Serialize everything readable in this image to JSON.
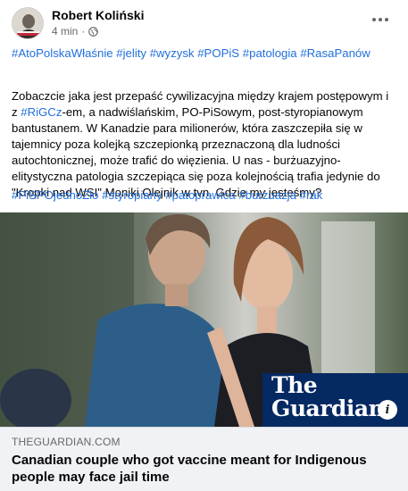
{
  "post": {
    "author": "Robert Koliński",
    "time": "4 min",
    "separator": "·",
    "privacy_icon": "globe-icon",
    "more_icon": "more-horizontal-icon",
    "tags_top": [
      "#AtoPolskaWłaśnie",
      "#jelity",
      "#wyzysk",
      "#POPiS",
      "#patologia",
      "#RasaPanów"
    ],
    "body_part1": "Zobaczcie jaka jest przepaść cywilizacyjna między krajem postępowym i z ",
    "body_tag": "#RiGCz",
    "body_part2": "-em, a nadwiślańskim, PO-PiSowym, post-styropianowym bantustanem. W Kanadzie para milionerów, która zaszczepiła się w tajemnicy poza kolejką szczepionką przeznaczoną dla ludności autochtonicznej, może trafić do więzienia. U nas - burżuazyjno-elitystyczna patologia szczepiąca się poza kolejnością trafia jedynie do \"Kropki nad WSI\" Moniki Olejnik w tvn. Gdzie my jesteśmy?",
    "tags_bottom": [
      "#PiSPOjednoZło",
      "#styropiany",
      "#patoprawica",
      "#burżuazja",
      "#rak"
    ]
  },
  "link": {
    "brand": "The Guardian",
    "brand_line1": "The",
    "brand_line2": "Guardian",
    "domain": "THEGUARDIAN.COM",
    "headline": "Canadian couple who got vaccine meant for Indigenous people may face jail time",
    "info_label": "i"
  },
  "colors": {
    "hashtag": "#216fdb",
    "guardian_blue": "#052962",
    "preview_bg": "#f0f2f5",
    "secondary_text": "#65676b"
  }
}
